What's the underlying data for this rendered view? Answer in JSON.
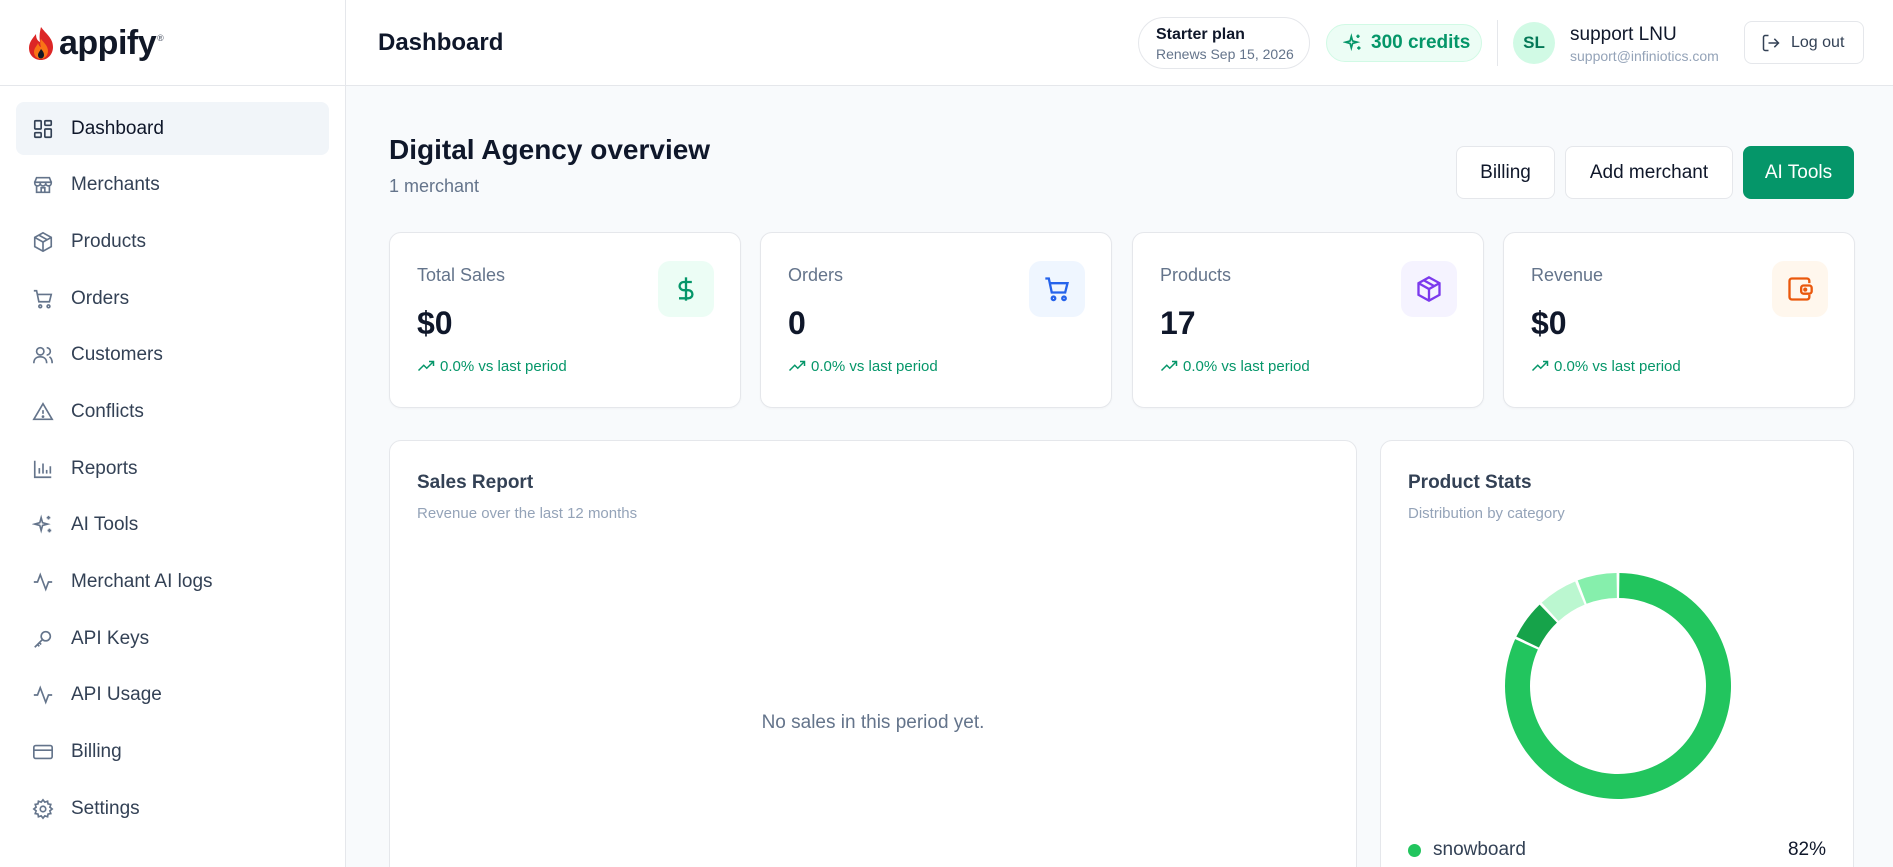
{
  "brand": {
    "name": "appify",
    "reg": "®"
  },
  "sidebar": {
    "items": [
      {
        "label": "Dashboard",
        "icon": "dashboard-grid-icon",
        "active": true
      },
      {
        "label": "Merchants",
        "icon": "store-icon"
      },
      {
        "label": "Products",
        "icon": "box-icon"
      },
      {
        "label": "Orders",
        "icon": "cart-icon"
      },
      {
        "label": "Customers",
        "icon": "users-icon"
      },
      {
        "label": "Conflicts",
        "icon": "warning-triangle-icon"
      },
      {
        "label": "Reports",
        "icon": "bar-chart-icon"
      },
      {
        "label": "AI Tools",
        "icon": "sparkles-icon"
      },
      {
        "label": "Merchant AI logs",
        "icon": "activity-icon"
      },
      {
        "label": "API Keys",
        "icon": "key-icon"
      },
      {
        "label": "API Usage",
        "icon": "activity-icon"
      },
      {
        "label": "Billing",
        "icon": "credit-card-icon"
      },
      {
        "label": "Settings",
        "icon": "gear-icon"
      }
    ]
  },
  "header": {
    "title": "Dashboard",
    "plan": {
      "name": "Starter plan",
      "renews": "Renews Sep 15, 2026"
    },
    "credits": "300 credits",
    "user": {
      "initials": "SL",
      "name": "support LNU",
      "email": "support@infiniotics.com"
    },
    "logout_label": "Log out"
  },
  "overview": {
    "title": "Digital Agency overview",
    "subtitle": "1 merchant",
    "buttons": {
      "billing": "Billing",
      "add_merchant": "Add merchant",
      "ai_tools": "AI Tools"
    }
  },
  "stats": [
    {
      "label": "Total Sales",
      "value": "$0",
      "trend": "0.0% vs last period",
      "icon": "dollar-icon",
      "icon_color": "#059669",
      "icon_bg": "#ecfdf5"
    },
    {
      "label": "Orders",
      "value": "0",
      "trend": "0.0% vs last period",
      "icon": "cart-icon",
      "icon_color": "#2563eb",
      "icon_bg": "#eff6ff"
    },
    {
      "label": "Products",
      "value": "17",
      "trend": "0.0% vs last period",
      "icon": "box-icon",
      "icon_color": "#7c3aed",
      "icon_bg": "#f5f3ff"
    },
    {
      "label": "Revenue",
      "value": "$0",
      "trend": "0.0% vs last period",
      "icon": "wallet-icon",
      "icon_color": "#ea580c",
      "icon_bg": "#fff7ed"
    }
  ],
  "sales_report": {
    "title": "Sales Report",
    "subtitle": "Revenue over the last 12 months",
    "empty_message": "No sales in this period yet."
  },
  "product_stats": {
    "title": "Product Stats",
    "subtitle": "Distribution by category",
    "legend": [
      {
        "label": "snowboard",
        "percent": "82%"
      }
    ]
  },
  "chart_data": {
    "type": "pie",
    "donut": true,
    "slices": [
      {
        "label": "snowboard",
        "value": 82,
        "color": "#22c55e"
      },
      {
        "value": 6,
        "color": "#16a34a"
      },
      {
        "value": 6,
        "color": "#bbf7d0"
      },
      {
        "value": 6,
        "color": "#86efac"
      }
    ]
  },
  "colors": {
    "accent": "#059669",
    "sidebar_active_bg": "#f1f5f9"
  }
}
